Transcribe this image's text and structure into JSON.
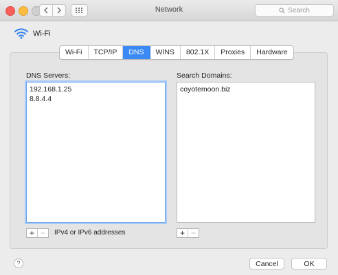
{
  "window": {
    "title": "Network",
    "search_placeholder": "Search"
  },
  "interface": {
    "name": "Wi-Fi",
    "icon": "wifi-icon"
  },
  "tabs": [
    {
      "label": "Wi-Fi",
      "active": false
    },
    {
      "label": "TCP/IP",
      "active": false
    },
    {
      "label": "DNS",
      "active": true
    },
    {
      "label": "WINS",
      "active": false
    },
    {
      "label": "802.1X",
      "active": false
    },
    {
      "label": "Proxies",
      "active": false
    },
    {
      "label": "Hardware",
      "active": false
    }
  ],
  "dns": {
    "label": "DNS Servers:",
    "servers": [
      "192.168.1.25",
      "8.8.4.4"
    ],
    "hint": "IPv4 or IPv6 addresses"
  },
  "search_domains": {
    "label": "Search Domains:",
    "domains": [
      "coyotemoon.biz"
    ]
  },
  "controls": {
    "plus": "+",
    "minus": "−"
  },
  "footer": {
    "help": "?",
    "cancel": "Cancel",
    "ok": "OK"
  },
  "colors": {
    "accent": "#3b89f5",
    "close": "#fc605c",
    "minimize": "#fdbc40"
  }
}
